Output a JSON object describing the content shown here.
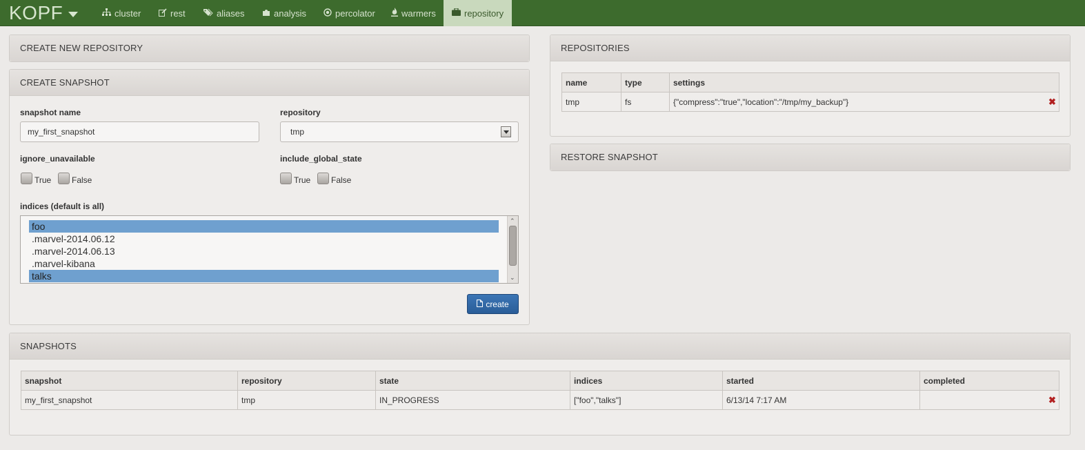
{
  "app": {
    "brand": "KOPF"
  },
  "nav": [
    {
      "label": "cluster",
      "icon": "sitemap-icon"
    },
    {
      "label": "rest",
      "icon": "edit-icon"
    },
    {
      "label": "aliases",
      "icon": "tags-icon"
    },
    {
      "label": "analysis",
      "icon": "puzzle-icon"
    },
    {
      "label": "percolator",
      "icon": "target-icon"
    },
    {
      "label": "warmers",
      "icon": "fire-icon"
    },
    {
      "label": "repository",
      "icon": "briefcase-icon",
      "active": true
    }
  ],
  "create_repo": {
    "title": "CREATE NEW REPOSITORY"
  },
  "create_snapshot": {
    "title": "CREATE SNAPSHOT",
    "name_label": "snapshot name",
    "name_value": "my_first_snapshot",
    "repo_label": "repository",
    "repo_value": "tmp",
    "ignore_label": "ignore_unavailable",
    "global_label": "include_global_state",
    "true_label": "True",
    "false_label": "False",
    "indices_label": "indices (default is all)",
    "indices": [
      {
        "name": "foo",
        "selected": true
      },
      {
        "name": ".marvel-2014.06.12",
        "selected": false
      },
      {
        "name": ".marvel-2014.06.13",
        "selected": false
      },
      {
        "name": ".marvel-kibana",
        "selected": false
      },
      {
        "name": "talks",
        "selected": true
      }
    ],
    "create_label": "create"
  },
  "repositories": {
    "title": "REPOSITORIES",
    "columns": [
      "name",
      "type",
      "settings"
    ],
    "rows": [
      {
        "name": "tmp",
        "type": "fs",
        "settings": "{\"compress\":\"true\",\"location\":\"/tmp/my_backup\"}"
      }
    ]
  },
  "restore": {
    "title": "RESTORE SNAPSHOT"
  },
  "snapshots": {
    "title": "SNAPSHOTS",
    "columns": [
      "snapshot",
      "repository",
      "state",
      "indices",
      "started",
      "completed"
    ],
    "rows": [
      {
        "snapshot": "my_first_snapshot",
        "repository": "tmp",
        "state": "IN_PROGRESS",
        "indices": "[\"foo\",\"talks\"]",
        "started": "6/13/14 7:17 AM",
        "completed": ""
      }
    ]
  },
  "colors": {
    "navbar": "#3d6b2d",
    "active_tab": "#c9d9bd",
    "primary_button": "#2f66a6",
    "delete": "#b22020"
  }
}
